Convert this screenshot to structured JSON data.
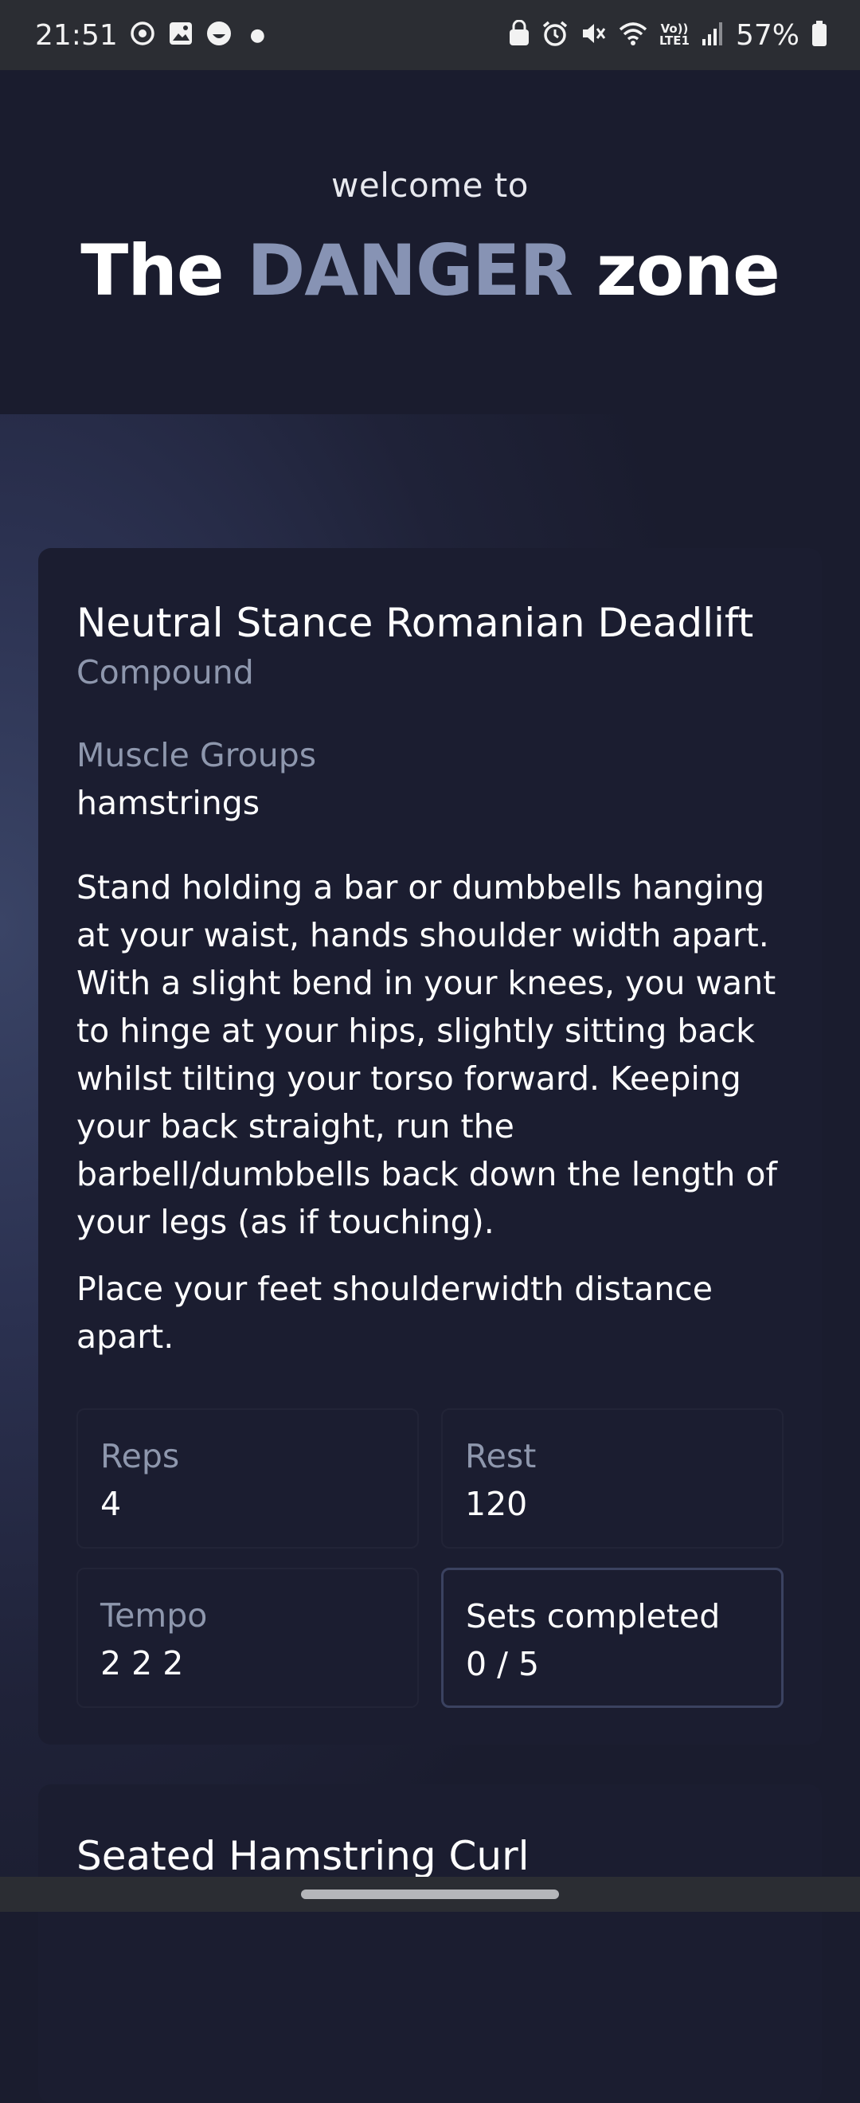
{
  "status_bar": {
    "time": "21:51",
    "left_icons": [
      "sync-icon",
      "image-icon",
      "face-icon",
      "dot-icon"
    ],
    "right_icons": [
      "lock-icon",
      "alarm-icon",
      "mute-icon",
      "wifi-icon",
      "volte-icon",
      "signal-icon"
    ],
    "volte_text": "Vo))\nLTE1",
    "battery": "57%"
  },
  "header": {
    "welcome": "welcome to",
    "title_pre": "The ",
    "title_accent": "DANGER",
    "title_post": " zone",
    "accent_color": "#8793b4"
  },
  "exercise": {
    "name": "Neutral Stance Romanian Deadlift",
    "type": "Compound",
    "muscle_groups_label": "Muscle Groups",
    "muscle_groups": "hamstrings",
    "description": "Stand holding a bar or dumbbells hanging at your waist, hands shoulder width apart. With a slight bend in your knees, you want to hinge at your hips, slightly sitting back whilst tilting your torso forward. Keeping your back straight, run the barbell/dumbbells back down the length of your legs (as if touching).",
    "note": "Place your feet shoulderwidth distance apart.",
    "stats": {
      "reps_label": "Reps",
      "reps": "4",
      "rest_label": "Rest",
      "rest": "120",
      "tempo_label": "Tempo",
      "tempo": "2 2 2",
      "sets_label": "Sets completed",
      "sets": "0 / 5"
    }
  },
  "next_exercise": {
    "name": "Seated Hamstring Curl"
  }
}
